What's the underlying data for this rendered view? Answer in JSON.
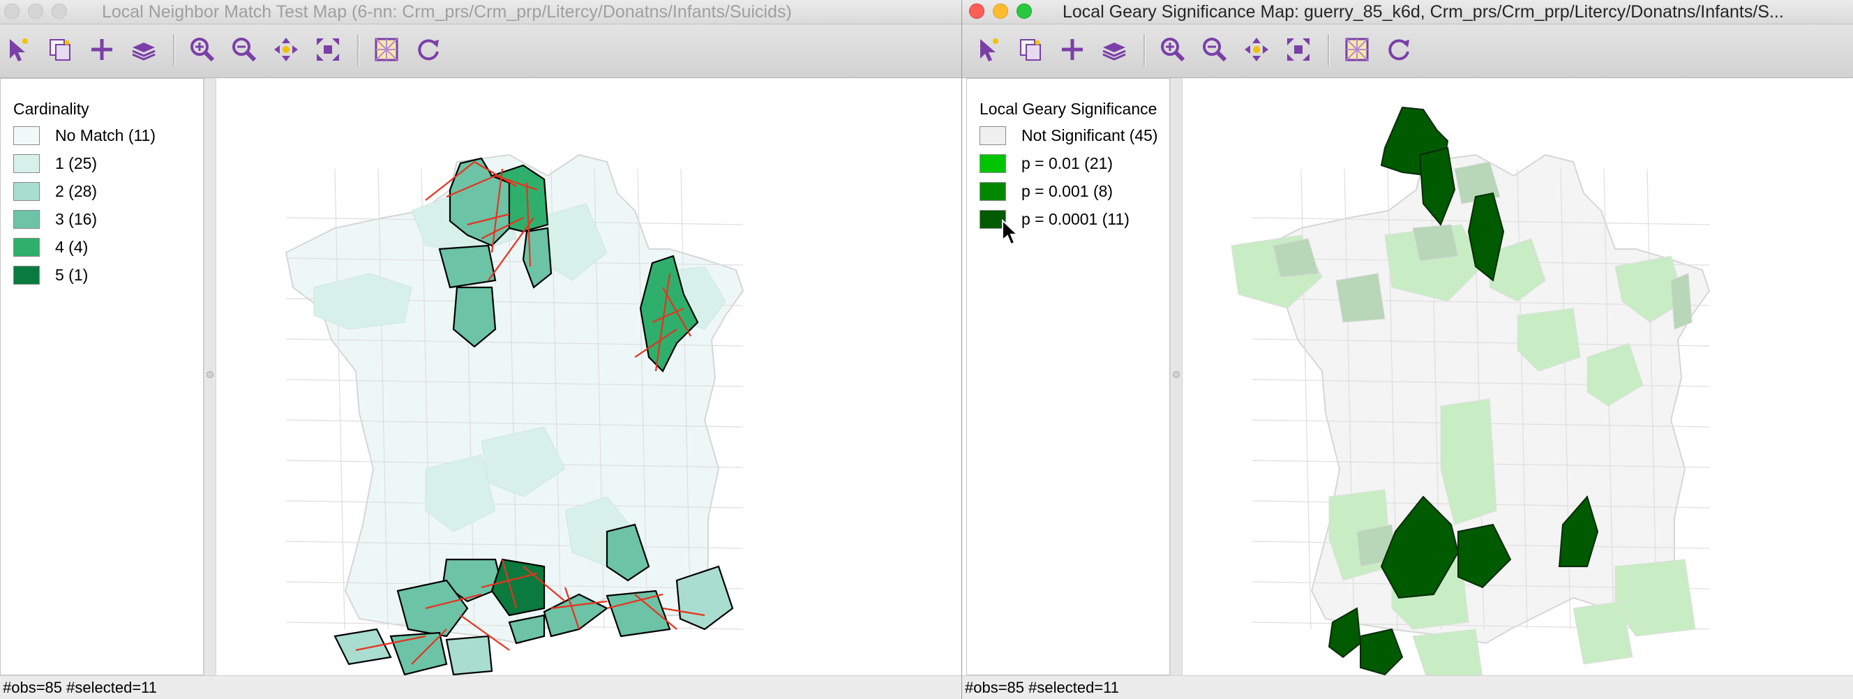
{
  "left_window": {
    "title": "Local Neighbor Match Test Map (6-nn: Crm_prs/Crm_prp/Litercy/Donatns/Infants/Suicids)",
    "legend": {
      "title": "Cardinality",
      "items": [
        {
          "label": "No Match (11)",
          "color": "#f2f9fb"
        },
        {
          "label": "1 (25)",
          "color": "#d8f0ea"
        },
        {
          "label": "2 (28)",
          "color": "#a9ddcf"
        },
        {
          "label": "3 (16)",
          "color": "#6cc3a6"
        },
        {
          "label": "4 (4)",
          "color": "#2faf6c"
        },
        {
          "label": "5 (1)",
          "color": "#0a7a3e"
        }
      ]
    },
    "status": "#obs=85 #selected=11"
  },
  "right_window": {
    "title": "Local Geary Significance Map: guerry_85_k6d, Crm_prs/Crm_prp/Litercy/Donatns/Infants/S...",
    "legend": {
      "title": "Local Geary Significance",
      "items": [
        {
          "label": "Not Significant (45)",
          "color": "#f0f0f0"
        },
        {
          "label": "p = 0.01 (21)",
          "color": "#00c400"
        },
        {
          "label": "p = 0.001 (8)",
          "color": "#008800"
        },
        {
          "label": "p = 0.0001 (11)",
          "color": "#005a00"
        }
      ]
    },
    "status": "#obs=85 #selected=11"
  },
  "toolbar_tools": [
    "select-tool",
    "copy-image-tool",
    "add-tool",
    "layers-tool",
    "zoom-in-tool",
    "zoom-out-tool",
    "pan-tool",
    "fit-extent-tool",
    "basemap-tool",
    "refresh-tool"
  ],
  "colors": {
    "accent": "#7b3fa8",
    "link_line": "#e8321e"
  }
}
